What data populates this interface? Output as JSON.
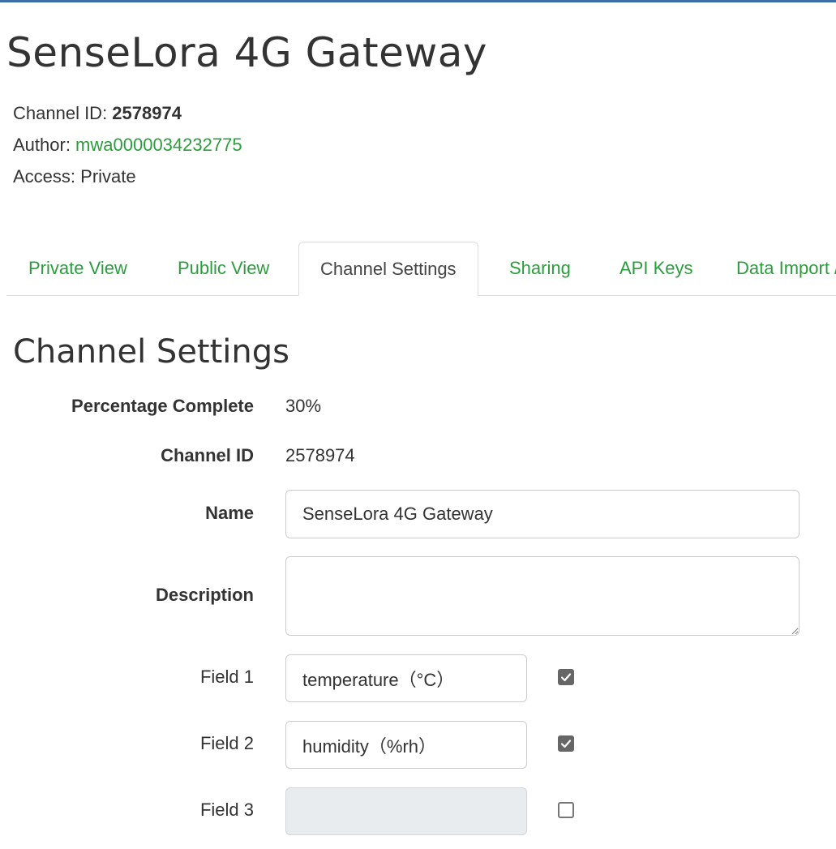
{
  "channel": {
    "title": "SenseLora 4G Gateway",
    "id_label": "Channel ID: ",
    "id_value": "2578974",
    "author_label": "Author: ",
    "author_value": "mwa0000034232775",
    "access_label": "Access: ",
    "access_value": "Private"
  },
  "tabs": [
    {
      "label": "Private View",
      "active": false
    },
    {
      "label": "Public View",
      "active": false
    },
    {
      "label": "Channel Settings",
      "active": true
    },
    {
      "label": "Sharing",
      "active": false
    },
    {
      "label": "API Keys",
      "active": false
    },
    {
      "label": "Data Import / Export",
      "active": false
    }
  ],
  "settings": {
    "title": "Channel Settings",
    "percentage_label": "Percentage Complete",
    "percentage_value": "30%",
    "channel_id_label": "Channel ID",
    "channel_id_value": "2578974",
    "name_label": "Name",
    "name_value": "SenseLora 4G Gateway",
    "description_label": "Description",
    "description_value": "",
    "fields": [
      {
        "label": "Field 1",
        "value": "temperature（°C）",
        "enabled": true
      },
      {
        "label": "Field 2",
        "value": "humidity（%rh）",
        "enabled": true
      },
      {
        "label": "Field 3",
        "value": "",
        "enabled": false
      }
    ]
  },
  "colors": {
    "accent_green": "#2a9d3c",
    "top_bar": "#3a6ea5",
    "checkbox_checked": "#666666",
    "disabled_input": "#e9ecef"
  }
}
